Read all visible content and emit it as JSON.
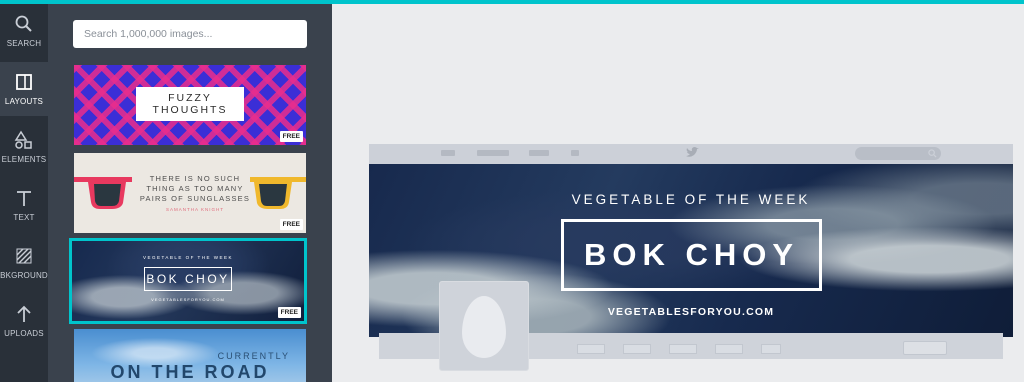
{
  "accent_color": "#00c4cc",
  "rail": {
    "items": [
      {
        "label": "SEARCH",
        "icon": "search-icon"
      },
      {
        "label": "LAYOUTS",
        "icon": "layouts-icon",
        "active": true
      },
      {
        "label": "ELEMENTS",
        "icon": "elements-icon"
      },
      {
        "label": "TEXT",
        "icon": "text-icon"
      },
      {
        "label": "BKGROUND",
        "icon": "background-icon"
      },
      {
        "label": "UPLOADS",
        "icon": "upload-icon"
      }
    ]
  },
  "panel": {
    "search_placeholder": "Search 1,000,000 images...",
    "thumbs": [
      {
        "title": "FUZZY\nTHOUGHTS",
        "badge": "FREE"
      },
      {
        "title": "THERE IS NO SUCH\nTHING AS TOO MANY\nPAIRS OF SUNGLASSES",
        "subtitle": "SAMANTHA KNIGHT",
        "badge": "FREE"
      },
      {
        "caption": "VEGETABLE OF THE WEEK",
        "title": "BOK CHOY",
        "url": "VEGETABLESFORYOU.COM",
        "badge": "FREE",
        "selected": true
      },
      {
        "small": "CURRENTLY",
        "title": "ON THE ROAD"
      }
    ]
  },
  "cover": {
    "caption": "VEGETABLE OF THE WEEK",
    "title": "BOK CHOY",
    "url": "VEGETABLESFORYOU.COM"
  }
}
